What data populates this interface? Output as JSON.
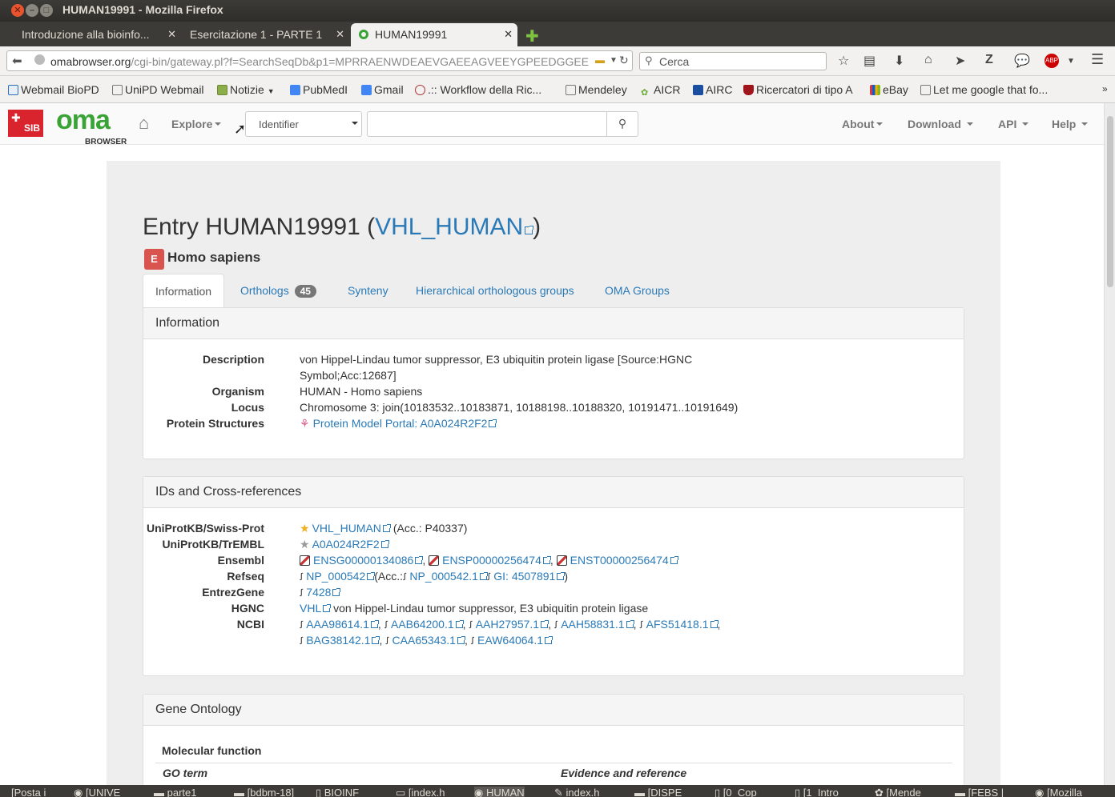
{
  "window": {
    "title": "HUMAN19991 - Mozilla Firefox"
  },
  "tabs": [
    {
      "label": "Introduzione alla bioinfo..."
    },
    {
      "label": "Esercitazione 1 - PARTE 1"
    },
    {
      "label": "HUMAN19991"
    }
  ],
  "browser": {
    "url_host": "omabrowser.org",
    "url_path": "/cgi-bin/gateway.pl?f=SearchSeqDb&p1=MPRRAENWDEAEVGAEEAGVEEYGPEEDGGEE",
    "search_placeholder": "Cerca"
  },
  "bookmarks": [
    "Webmail BioPD",
    "UniPD Webmail",
    "Notizie",
    "PubMedI",
    "Gmail",
    ".:: Workflow della Ric...",
    "Mendeley",
    "AICR",
    "AIRC",
    "Ricercatori di tipo A",
    "eBay",
    "Let me google that fo..."
  ],
  "oma_nav": {
    "sib": "SIB",
    "logo": "oma",
    "logo_sub": "BROWSER",
    "explore": "Explore",
    "select_value": "Identifier",
    "menus": [
      "About",
      "Download",
      "API",
      "Help"
    ]
  },
  "entry": {
    "prefix": "Entry HUMAN19991 (",
    "link": "VHL_HUMAN",
    "suffix": ")",
    "kingdom": "E",
    "species": "Homo sapiens"
  },
  "page_tabs": [
    {
      "label": "Information"
    },
    {
      "label": "Orthologs",
      "badge": "45"
    },
    {
      "label": "Synteny"
    },
    {
      "label": "Hierarchical orthologous groups"
    },
    {
      "label": "OMA Groups"
    }
  ],
  "information": {
    "heading": "Information",
    "description_key": "Description",
    "description_line1": "von Hippel-Lindau tumor suppressor, E3 ubiquitin protein ligase [Source:HGNC",
    "description_line2": "Symbol;Acc:12687]",
    "organism_key": "Organism",
    "organism": "HUMAN - Homo sapiens",
    "locus_key": "Locus",
    "locus": "Chromosome 3: join(10183532..10183871, 10188198..10188320, 10191471..10191649)",
    "structures_key": "Protein Structures",
    "structures": "Protein Model Portal: A0A024R2F2"
  },
  "xrefs": {
    "heading": "IDs and Cross-references",
    "swissprot_key": "UniProtKB/Swiss-Prot",
    "swissprot": "VHL_HUMAN",
    "swissprot_acc": "(Acc.: P40337)",
    "trembl_key": "UniProtKB/TrEMBL",
    "trembl": "A0A024R2F2",
    "ensembl_key": "Ensembl",
    "ensembl": [
      "ENSG00000134086",
      "ENSP00000256474",
      "ENST00000256474"
    ],
    "refseq_key": "Refseq",
    "refseq": "NP_000542",
    "refseq_acc_label": "(Acc.:",
    "refseq_acc": "NP_000542.1",
    "refseq_gi": "GI: 4507891",
    "entrez_key": "EntrezGene",
    "entrez": "7428",
    "hgnc_key": "HGNC",
    "hgnc": "VHL",
    "hgnc_desc": "von Hippel-Lindau tumor suppressor, E3 ubiquitin protein ligase",
    "ncbi_key": "NCBI",
    "ncbi_line1": [
      "AAA98614.1",
      "AAB64200.1",
      "AAH27957.1",
      "AAH58831.1",
      "AFS51418.1"
    ],
    "ncbi_line2": [
      "BAG38142.1",
      "CAA65343.1",
      "EAW64064.1"
    ]
  },
  "go": {
    "heading": "Gene Ontology",
    "section": "Molecular function",
    "col1": "GO term",
    "col2": "Evidence and reference"
  },
  "taskbar": [
    "[Posta i",
    "[UNIVE",
    "parte1",
    "[bdbm-18]",
    "BIOINF",
    "[index.h",
    "HUMAN",
    "index.h",
    "[DISPE",
    "[0_Cop",
    "[1_Intro",
    "[Mende",
    "[FEBS |",
    "[Mozilla"
  ]
}
